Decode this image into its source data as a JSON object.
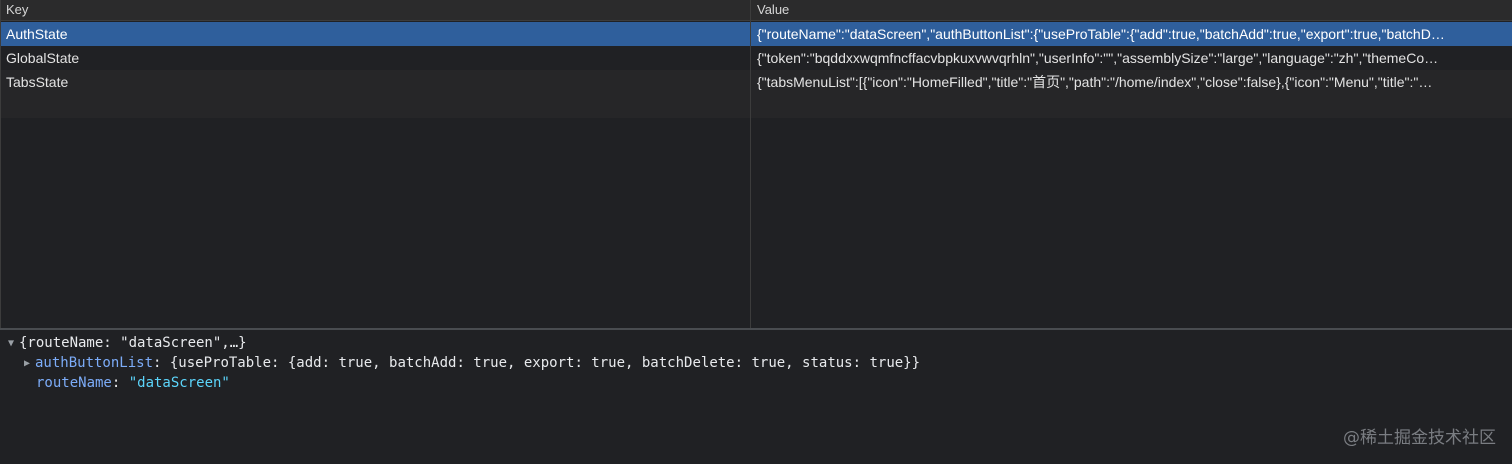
{
  "table": {
    "columns": {
      "key": "Key",
      "value": "Value"
    },
    "rows": [
      {
        "key": "AuthState",
        "value": "{\"routeName\":\"dataScreen\",\"authButtonList\":{\"useProTable\":{\"add\":true,\"batchAdd\":true,\"export\":true,\"batchD…"
      },
      {
        "key": "GlobalState",
        "value": "{\"token\":\"bqddxxwqmfncffacvbpkuxvwvqrhln\",\"userInfo\":\"\",\"assemblySize\":\"large\",\"language\":\"zh\",\"themeCo…"
      },
      {
        "key": "TabsState",
        "value": "{\"tabsMenuList\":[{\"icon\":\"HomeFilled\",\"title\":\"首页\",\"path\":\"/home/index\",\"close\":false},{\"icon\":\"Menu\",\"title\":\"…"
      }
    ],
    "selected_row": 0,
    "colors": {
      "selected": "#2f5f9c"
    }
  },
  "preview": {
    "root_summary": "{routeName: \"dataScreen\",…}",
    "children": [
      {
        "key": "authButtonList",
        "value": "{useProTable: {add: true, batchAdd: true, export: true, batchDelete: true, status: true}}",
        "expanded": false
      },
      {
        "key": "routeName",
        "value": "\"dataScreen\""
      }
    ]
  },
  "watermark": "@稀土掘金技术社区"
}
